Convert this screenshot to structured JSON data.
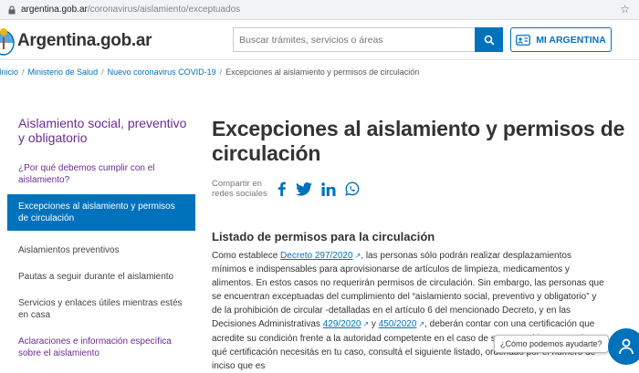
{
  "browser": {
    "url_host": "argentina.gob.ar",
    "url_path": "/coronavirus/aislamiento/exceptuados"
  },
  "header": {
    "logo_text": "Argentina.gob.ar",
    "search_placeholder": "Buscar trámites, servicios o áreas",
    "mi_argentina_label": "MI ARGENTINA"
  },
  "breadcrumb": {
    "items": [
      "Inicio",
      "Ministerio de Salud",
      "Nuevo coronavirus COVID-19"
    ],
    "current": "Excepciones al aislamiento y permisos de circulación",
    "separator": "/"
  },
  "sidebar": {
    "title": "Aislamiento social, preventivo y obligatorio",
    "items": [
      "¿Por qué debemos cumplir con el aislamiento?",
      "Excepciones al aislamiento y permisos de circulación",
      "Aislamientos preventivos",
      "Pautas a seguir durante el aislamiento",
      "Servicios y enlaces útiles mientras estés en casa",
      "Aclaraciones e información específica sobre el aislamiento"
    ]
  },
  "main": {
    "title": "Excepciones al aislamiento y permisos de circulación",
    "share_label": "Compartir en redes sociales",
    "section_title": "Listado de permisos para la circulación",
    "p1": "Como establece ",
    "link_decreto": "Decreto 297/2020",
    "p2": ", las personas sólo podrán realizar desplazamientos mínimos e indispensables para aprovisionarse de artículos de limpieza, medicamentos y alimentos. En estos casos no requerirán permisos de circulación. Sin embargo, las personas que se encuentran exceptuadas del cumplimiento del “aislamiento social, preventivo y obligatorio” y de la prohibición de circular -detalladas en el artículo 6 del mencionado Decreto, y en las Decisiones Administrativas ",
    "link_429": "429/2020",
    "p3": " y ",
    "link_450": "450/2020",
    "p4": ", deberán contar con una certificación que acredite su condición frente a la autoridad competente en el caso de ser requerido. Para saber qué certificación necesitás en tu caso, consultá el siguiente listado, ordenado por el número de inciso que es"
  },
  "chat": {
    "prompt": "¿Cómo podemos ayudarte?"
  },
  "colors": {
    "brand_blue": "#0072bb",
    "sidebar_purple": "#6a2c91"
  }
}
